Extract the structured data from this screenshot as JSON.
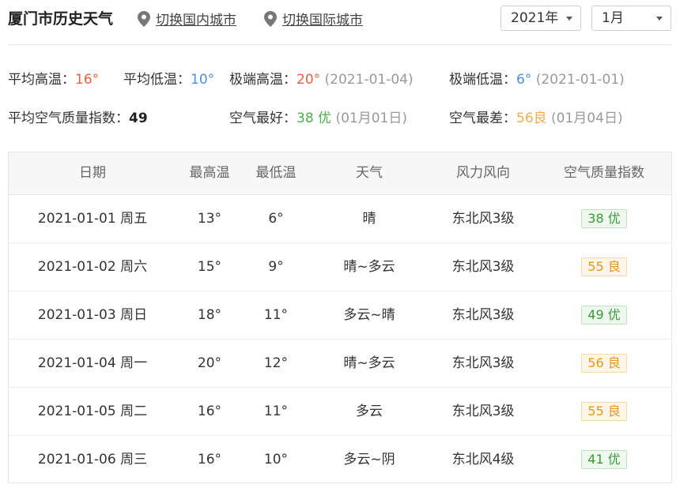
{
  "header": {
    "title": "厦门市历史天气",
    "switch_domestic": "切换国内城市",
    "switch_international": "切换国际城市",
    "year_value": "2021年",
    "month_value": "1月"
  },
  "summary": {
    "avg_high_label": "平均高温：",
    "avg_high_value": "16°",
    "avg_low_label": "平均低温：",
    "avg_low_value": "10°",
    "max_high_label": "极端高温：",
    "max_high_value": "20°",
    "max_high_date": "(2021-01-04)",
    "min_low_label": "极端低温：",
    "min_low_value": "6°",
    "min_low_date": "(2021-01-01)",
    "avg_aqi_label": "平均空气质量指数：",
    "avg_aqi_value": "49",
    "best_air_label": "空气最好：",
    "best_air_value": "38 优",
    "best_air_date": "(01月01日)",
    "worst_air_label": "空气最差：",
    "worst_air_value": "56良",
    "worst_air_date": "(01月04日)"
  },
  "table": {
    "headers": [
      "日期",
      "最高温",
      "最低温",
      "天气",
      "风力风向",
      "空气质量指数"
    ],
    "rows": [
      {
        "date": "2021-01-01 周五",
        "high": "13°",
        "low": "6°",
        "weather": "晴",
        "wind": "东北风3级",
        "aqi": "38 优",
        "aqi_level": "good"
      },
      {
        "date": "2021-01-02 周六",
        "high": "15°",
        "low": "9°",
        "weather": "晴~多云",
        "wind": "东北风3级",
        "aqi": "55 良",
        "aqi_level": "mid"
      },
      {
        "date": "2021-01-03 周日",
        "high": "18°",
        "low": "11°",
        "weather": "多云~晴",
        "wind": "东北风3级",
        "aqi": "49 优",
        "aqi_level": "good"
      },
      {
        "date": "2021-01-04 周一",
        "high": "20°",
        "low": "12°",
        "weather": "晴~多云",
        "wind": "东北风3级",
        "aqi": "56 良",
        "aqi_level": "mid"
      },
      {
        "date": "2021-01-05 周二",
        "high": "16°",
        "low": "11°",
        "weather": "多云",
        "wind": "东北风3级",
        "aqi": "55 良",
        "aqi_level": "mid"
      },
      {
        "date": "2021-01-06 周三",
        "high": "16°",
        "low": "10°",
        "weather": "多云~阴",
        "wind": "东北风4级",
        "aqi": "41 优",
        "aqi_level": "good"
      }
    ]
  },
  "colors": {
    "hot": "#e8603c",
    "cold": "#4a90d9",
    "good": "#4cae4c",
    "mid": "#f0ad4e"
  }
}
